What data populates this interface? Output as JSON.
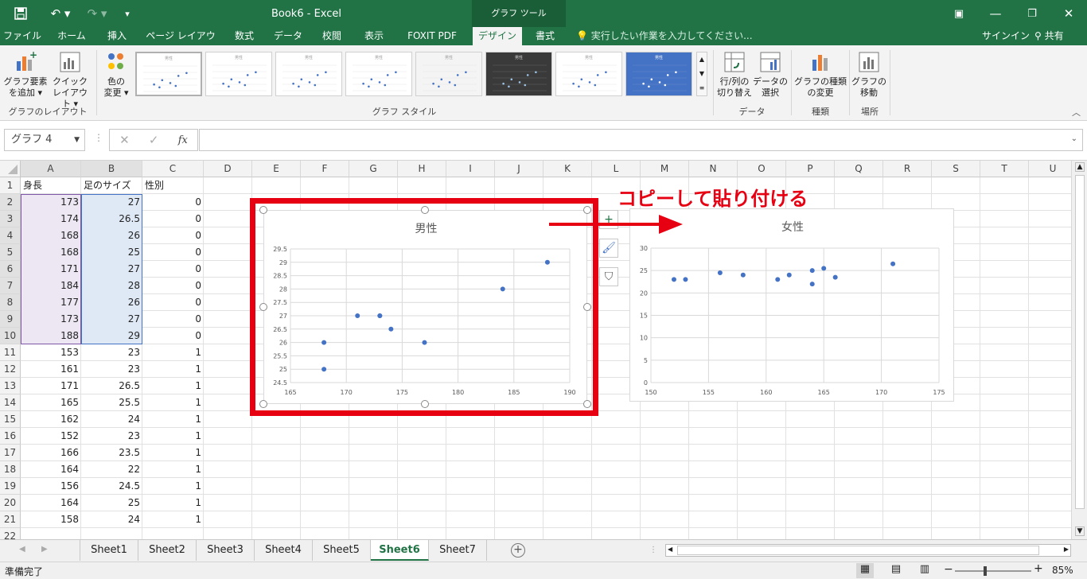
{
  "app": {
    "title": "Book6 - Excel",
    "context_tab": "グラフ ツール",
    "signin": "サインイン",
    "share": "共有",
    "tell_me": "実行したい作業を入力してください..."
  },
  "tabs": [
    "ファイル",
    "ホーム",
    "挿入",
    "ページ レイアウト",
    "数式",
    "データ",
    "校閲",
    "表示",
    "FOXIT PDF",
    "デザイン",
    "書式"
  ],
  "ribbon": {
    "add_element": [
      "グラフ要素",
      "を追加"
    ],
    "quick_layout": [
      "クイック",
      "レイアウト"
    ],
    "colors": [
      "色の",
      "変更"
    ],
    "switch_row_col": [
      "行/列の",
      "切り替え"
    ],
    "select_data": [
      "データの",
      "選択"
    ],
    "change_type": [
      "グラフの種類",
      "の変更"
    ],
    "move_chart": [
      "グラフの",
      "移動"
    ],
    "groups": {
      "layout": "グラフのレイアウト",
      "styles": "グラフ スタイル",
      "data": "データ",
      "type": "種類",
      "location": "場所"
    },
    "style_titles": [
      "男性",
      "男性",
      "男性",
      "男性",
      "男性",
      "男性",
      "男性",
      "男性"
    ]
  },
  "formula_bar": {
    "name_box": "グラフ 4",
    "fx": "fx",
    "value": ""
  },
  "columns": [
    "A",
    "B",
    "C",
    "D",
    "E",
    "F",
    "G",
    "H",
    "I",
    "J",
    "K",
    "L",
    "M",
    "N",
    "O",
    "P",
    "Q",
    "R",
    "S",
    "T",
    "U"
  ],
  "rows": [
    [
      "身長",
      "足のサイズ",
      "性別"
    ],
    [
      "173",
      "27",
      "0"
    ],
    [
      "174",
      "26.5",
      "0"
    ],
    [
      "168",
      "26",
      "0"
    ],
    [
      "168",
      "25",
      "0"
    ],
    [
      "171",
      "27",
      "0"
    ],
    [
      "184",
      "28",
      "0"
    ],
    [
      "177",
      "26",
      "0"
    ],
    [
      "173",
      "27",
      "0"
    ],
    [
      "188",
      "29",
      "0"
    ],
    [
      "153",
      "23",
      "1"
    ],
    [
      "161",
      "23",
      "1"
    ],
    [
      "171",
      "26.5",
      "1"
    ],
    [
      "165",
      "25.5",
      "1"
    ],
    [
      "162",
      "24",
      "1"
    ],
    [
      "152",
      "23",
      "1"
    ],
    [
      "166",
      "23.5",
      "1"
    ],
    [
      "164",
      "22",
      "1"
    ],
    [
      "156",
      "24.5",
      "1"
    ],
    [
      "164",
      "25",
      "1"
    ],
    [
      "158",
      "24",
      "1"
    ],
    [
      "",
      "",
      ""
    ]
  ],
  "annotation": "コピーして貼り付ける",
  "chart_data": [
    {
      "type": "scatter",
      "title": "男性",
      "xlim": [
        165,
        190
      ],
      "ylim": [
        24.5,
        29.5
      ],
      "x_ticks": [
        "165",
        "170",
        "175",
        "180",
        "185",
        "190"
      ],
      "y_ticks": [
        "24.5",
        "25",
        "25.5",
        "26",
        "26.5",
        "27",
        "27.5",
        "28",
        "28.5",
        "29",
        "29.5"
      ],
      "x": [
        173,
        174,
        168,
        168,
        171,
        184,
        177,
        173,
        188
      ],
      "y": [
        27,
        26.5,
        26,
        25,
        27,
        28,
        26,
        27,
        29
      ],
      "color": "#4472c4",
      "grid": true
    },
    {
      "type": "scatter",
      "title": "女性",
      "xlim": [
        150,
        175
      ],
      "ylim": [
        0,
        30
      ],
      "x_ticks": [
        "150",
        "155",
        "160",
        "165",
        "170",
        "175"
      ],
      "y_ticks": [
        "0",
        "5",
        "10",
        "15",
        "20",
        "25",
        "30"
      ],
      "x": [
        153,
        161,
        171,
        165,
        162,
        152,
        166,
        164,
        156,
        164,
        158
      ],
      "y": [
        23,
        23,
        26.5,
        25.5,
        24,
        23,
        23.5,
        22,
        24.5,
        25,
        24
      ],
      "color": "#4472c4",
      "grid": true
    }
  ],
  "sheets": [
    "Sheet1",
    "Sheet2",
    "Sheet3",
    "Sheet4",
    "Sheet5",
    "Sheet6",
    "Sheet7"
  ],
  "active_sheet": "Sheet6",
  "status": {
    "ready": "準備完了",
    "zoom": "85%"
  },
  "colors": {
    "excel_green": "#217346",
    "highlight_red": "#e60012",
    "series_blue": "#4472c4"
  }
}
